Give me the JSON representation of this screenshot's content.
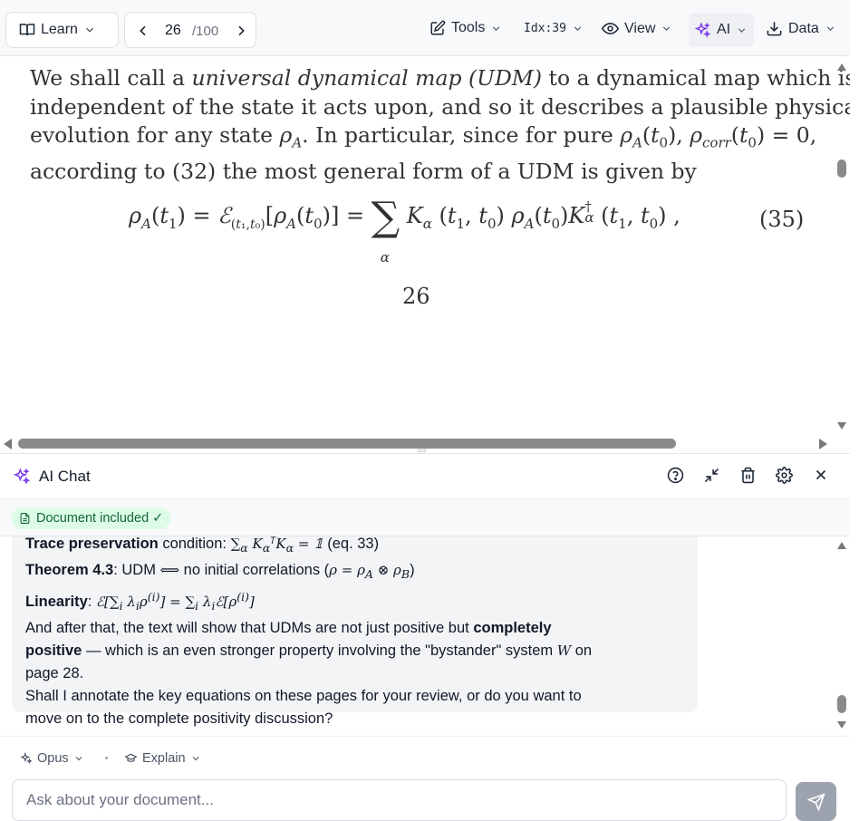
{
  "toolbar": {
    "learn_label": "Learn",
    "page_current": "26",
    "page_total": "/100",
    "tools_label": "Tools",
    "idx_label": "Idx:39",
    "view_label": "View",
    "ai_label": "AI",
    "data_label": "Data",
    "ai_accent": "#7c3aed"
  },
  "document": {
    "para_line1_a": "We shall call a ",
    "para_line1_term": "universal dynamical map (UDM)",
    "para_line1_b": " to a dynamical map which is",
    "para_line2": "independent of the state it acts upon, and so it describes a plausible physical",
    "para_line3_a": "evolution for any state ",
    "para_line3_b": ". In particular, since for pure ",
    "para_line4": "according to (32) the most general form of a UDM is given by",
    "equation_number": "(35)",
    "page_number": "26"
  },
  "chat": {
    "title": "AI Chat",
    "document_badge": "Document included ✓",
    "message": {
      "line0_bold": "Trace preservation",
      "line0_rest": " condition: ",
      "line0_tail": " (eq. 33)",
      "line1_bold": "Theorem 4.3",
      "line1_a": ": UDM ",
      "line1_b": " no initial correlations (",
      "line1_c": ")",
      "line2_bold": "Linearity",
      "line2_a": ": ",
      "line3_a": "And after that, the text will show that UDMs are not just positive but ",
      "line3_bold": "completely",
      "line4_bold": "positive",
      "line4_a": " — which is an even stronger property involving the \"bystander\" system ",
      "line4_b": " on",
      "line5": "page 28.",
      "line6": "Shall I annotate the key equations on these pages for your review, or do you want to",
      "line7": "move on to the complete positivity discussion?"
    },
    "model_label": "Opus",
    "mode_label": "Explain",
    "input_placeholder": "Ask about your document..."
  }
}
